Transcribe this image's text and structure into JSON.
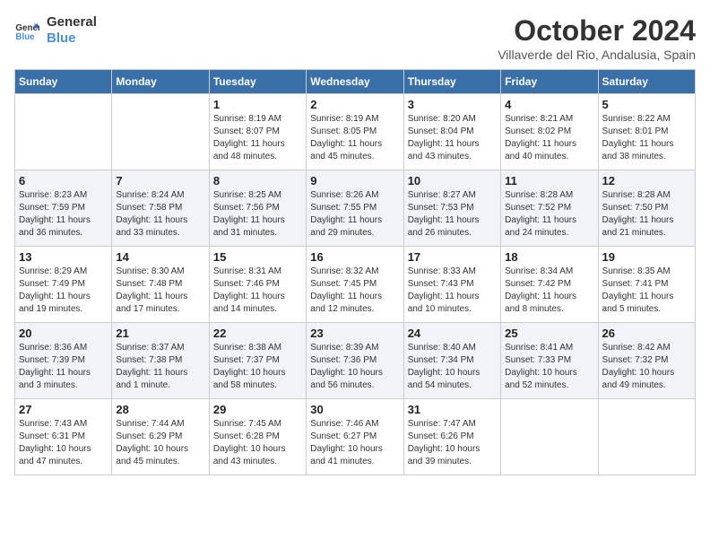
{
  "logo": {
    "line1": "General",
    "line2": "Blue"
  },
  "title": "October 2024",
  "location": "Villaverde del Rio, Andalusia, Spain",
  "weekdays": [
    "Sunday",
    "Monday",
    "Tuesday",
    "Wednesday",
    "Thursday",
    "Friday",
    "Saturday"
  ],
  "weeks": [
    [
      {
        "day": "",
        "info": ""
      },
      {
        "day": "",
        "info": ""
      },
      {
        "day": "1",
        "info": "Sunrise: 8:19 AM\nSunset: 8:07 PM\nDaylight: 11 hours\nand 48 minutes."
      },
      {
        "day": "2",
        "info": "Sunrise: 8:19 AM\nSunset: 8:05 PM\nDaylight: 11 hours\nand 45 minutes."
      },
      {
        "day": "3",
        "info": "Sunrise: 8:20 AM\nSunset: 8:04 PM\nDaylight: 11 hours\nand 43 minutes."
      },
      {
        "day": "4",
        "info": "Sunrise: 8:21 AM\nSunset: 8:02 PM\nDaylight: 11 hours\nand 40 minutes."
      },
      {
        "day": "5",
        "info": "Sunrise: 8:22 AM\nSunset: 8:01 PM\nDaylight: 11 hours\nand 38 minutes."
      }
    ],
    [
      {
        "day": "6",
        "info": "Sunrise: 8:23 AM\nSunset: 7:59 PM\nDaylight: 11 hours\nand 36 minutes."
      },
      {
        "day": "7",
        "info": "Sunrise: 8:24 AM\nSunset: 7:58 PM\nDaylight: 11 hours\nand 33 minutes."
      },
      {
        "day": "8",
        "info": "Sunrise: 8:25 AM\nSunset: 7:56 PM\nDaylight: 11 hours\nand 31 minutes."
      },
      {
        "day": "9",
        "info": "Sunrise: 8:26 AM\nSunset: 7:55 PM\nDaylight: 11 hours\nand 29 minutes."
      },
      {
        "day": "10",
        "info": "Sunrise: 8:27 AM\nSunset: 7:53 PM\nDaylight: 11 hours\nand 26 minutes."
      },
      {
        "day": "11",
        "info": "Sunrise: 8:28 AM\nSunset: 7:52 PM\nDaylight: 11 hours\nand 24 minutes."
      },
      {
        "day": "12",
        "info": "Sunrise: 8:28 AM\nSunset: 7:50 PM\nDaylight: 11 hours\nand 21 minutes."
      }
    ],
    [
      {
        "day": "13",
        "info": "Sunrise: 8:29 AM\nSunset: 7:49 PM\nDaylight: 11 hours\nand 19 minutes."
      },
      {
        "day": "14",
        "info": "Sunrise: 8:30 AM\nSunset: 7:48 PM\nDaylight: 11 hours\nand 17 minutes."
      },
      {
        "day": "15",
        "info": "Sunrise: 8:31 AM\nSunset: 7:46 PM\nDaylight: 11 hours\nand 14 minutes."
      },
      {
        "day": "16",
        "info": "Sunrise: 8:32 AM\nSunset: 7:45 PM\nDaylight: 11 hours\nand 12 minutes."
      },
      {
        "day": "17",
        "info": "Sunrise: 8:33 AM\nSunset: 7:43 PM\nDaylight: 11 hours\nand 10 minutes."
      },
      {
        "day": "18",
        "info": "Sunrise: 8:34 AM\nSunset: 7:42 PM\nDaylight: 11 hours\nand 8 minutes."
      },
      {
        "day": "19",
        "info": "Sunrise: 8:35 AM\nSunset: 7:41 PM\nDaylight: 11 hours\nand 5 minutes."
      }
    ],
    [
      {
        "day": "20",
        "info": "Sunrise: 8:36 AM\nSunset: 7:39 PM\nDaylight: 11 hours\nand 3 minutes."
      },
      {
        "day": "21",
        "info": "Sunrise: 8:37 AM\nSunset: 7:38 PM\nDaylight: 11 hours\nand 1 minute."
      },
      {
        "day": "22",
        "info": "Sunrise: 8:38 AM\nSunset: 7:37 PM\nDaylight: 10 hours\nand 58 minutes."
      },
      {
        "day": "23",
        "info": "Sunrise: 8:39 AM\nSunset: 7:36 PM\nDaylight: 10 hours\nand 56 minutes."
      },
      {
        "day": "24",
        "info": "Sunrise: 8:40 AM\nSunset: 7:34 PM\nDaylight: 10 hours\nand 54 minutes."
      },
      {
        "day": "25",
        "info": "Sunrise: 8:41 AM\nSunset: 7:33 PM\nDaylight: 10 hours\nand 52 minutes."
      },
      {
        "day": "26",
        "info": "Sunrise: 8:42 AM\nSunset: 7:32 PM\nDaylight: 10 hours\nand 49 minutes."
      }
    ],
    [
      {
        "day": "27",
        "info": "Sunrise: 7:43 AM\nSunset: 6:31 PM\nDaylight: 10 hours\nand 47 minutes."
      },
      {
        "day": "28",
        "info": "Sunrise: 7:44 AM\nSunset: 6:29 PM\nDaylight: 10 hours\nand 45 minutes."
      },
      {
        "day": "29",
        "info": "Sunrise: 7:45 AM\nSunset: 6:28 PM\nDaylight: 10 hours\nand 43 minutes."
      },
      {
        "day": "30",
        "info": "Sunrise: 7:46 AM\nSunset: 6:27 PM\nDaylight: 10 hours\nand 41 minutes."
      },
      {
        "day": "31",
        "info": "Sunrise: 7:47 AM\nSunset: 6:26 PM\nDaylight: 10 hours\nand 39 minutes."
      },
      {
        "day": "",
        "info": ""
      },
      {
        "day": "",
        "info": ""
      }
    ]
  ]
}
